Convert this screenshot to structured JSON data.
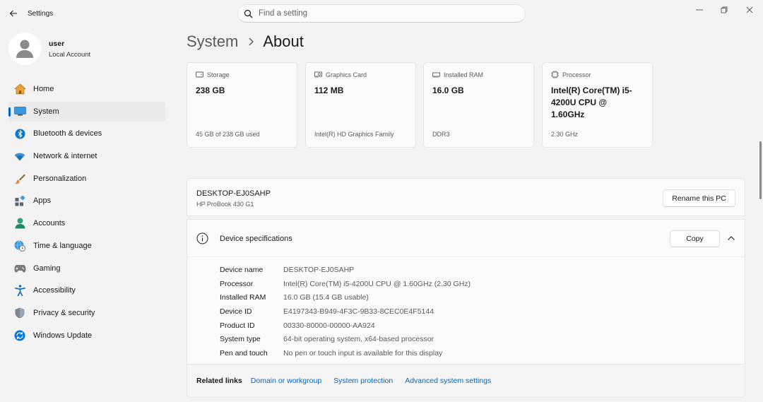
{
  "titlebar": {
    "app_title": "Settings",
    "search_placeholder": "Find a setting"
  },
  "profile": {
    "name": "user",
    "account_type": "Local Account"
  },
  "sidebar": {
    "items": [
      {
        "label": "Home",
        "icon": "home-icon",
        "active": false
      },
      {
        "label": "System",
        "icon": "system-icon",
        "active": true
      },
      {
        "label": "Bluetooth & devices",
        "icon": "bluetooth-icon",
        "active": false
      },
      {
        "label": "Network & internet",
        "icon": "wifi-icon",
        "active": false
      },
      {
        "label": "Personalization",
        "icon": "brush-icon",
        "active": false
      },
      {
        "label": "Apps",
        "icon": "apps-icon",
        "active": false
      },
      {
        "label": "Accounts",
        "icon": "accounts-icon",
        "active": false
      },
      {
        "label": "Time & language",
        "icon": "globe-clock-icon",
        "active": false
      },
      {
        "label": "Gaming",
        "icon": "gamepad-icon",
        "active": false
      },
      {
        "label": "Accessibility",
        "icon": "accessibility-icon",
        "active": false
      },
      {
        "label": "Privacy & security",
        "icon": "shield-icon",
        "active": false
      },
      {
        "label": "Windows Update",
        "icon": "update-icon",
        "active": false
      }
    ]
  },
  "breadcrumb": {
    "parent": "System",
    "current": "About"
  },
  "cards": [
    {
      "label": "Storage",
      "value": "238 GB",
      "sub": "45 GB of 238 GB used",
      "icon": "storage-icon"
    },
    {
      "label": "Graphics Card",
      "value": "112 MB",
      "sub": "Intel(R) HD Graphics Family",
      "icon": "graphics-card-icon"
    },
    {
      "label": "Installed RAM",
      "value": "16.0 GB",
      "sub": "DDR3",
      "icon": "ram-icon"
    },
    {
      "label": "Processor",
      "value": "Intel(R) Core(TM) i5-4200U CPU @ 1.60GHz",
      "sub": "2.30 GHz",
      "icon": "processor-icon"
    }
  ],
  "pc": {
    "name": "DESKTOP-EJ0SAHP",
    "model": "HP ProBook 430 G1",
    "rename_label": "Rename this PC"
  },
  "specs": {
    "title": "Device specifications",
    "copy_label": "Copy",
    "rows": [
      {
        "label": "Device name",
        "value": "DESKTOP-EJ0SAHP"
      },
      {
        "label": "Processor",
        "value": "Intel(R) Core(TM) i5-4200U CPU @ 1.60GHz (2.30 GHz)"
      },
      {
        "label": "Installed RAM",
        "value": "16.0 GB (15.4 GB usable)"
      },
      {
        "label": "Device ID",
        "value": "E4197343-B949-4F3C-9B33-8CEC0E4F5144"
      },
      {
        "label": "Product ID",
        "value": "00330-80000-00000-AA924"
      },
      {
        "label": "System type",
        "value": "64-bit operating system, x64-based processor"
      },
      {
        "label": "Pen and touch",
        "value": "No pen or touch input is available for this display"
      }
    ]
  },
  "related_links": {
    "label": "Related links",
    "links": [
      "Domain or workgroup",
      "System protection",
      "Advanced system settings"
    ]
  },
  "colors": {
    "accent": "#0067c0",
    "background": "#f3f3f3",
    "card": "#fbfbfb"
  }
}
